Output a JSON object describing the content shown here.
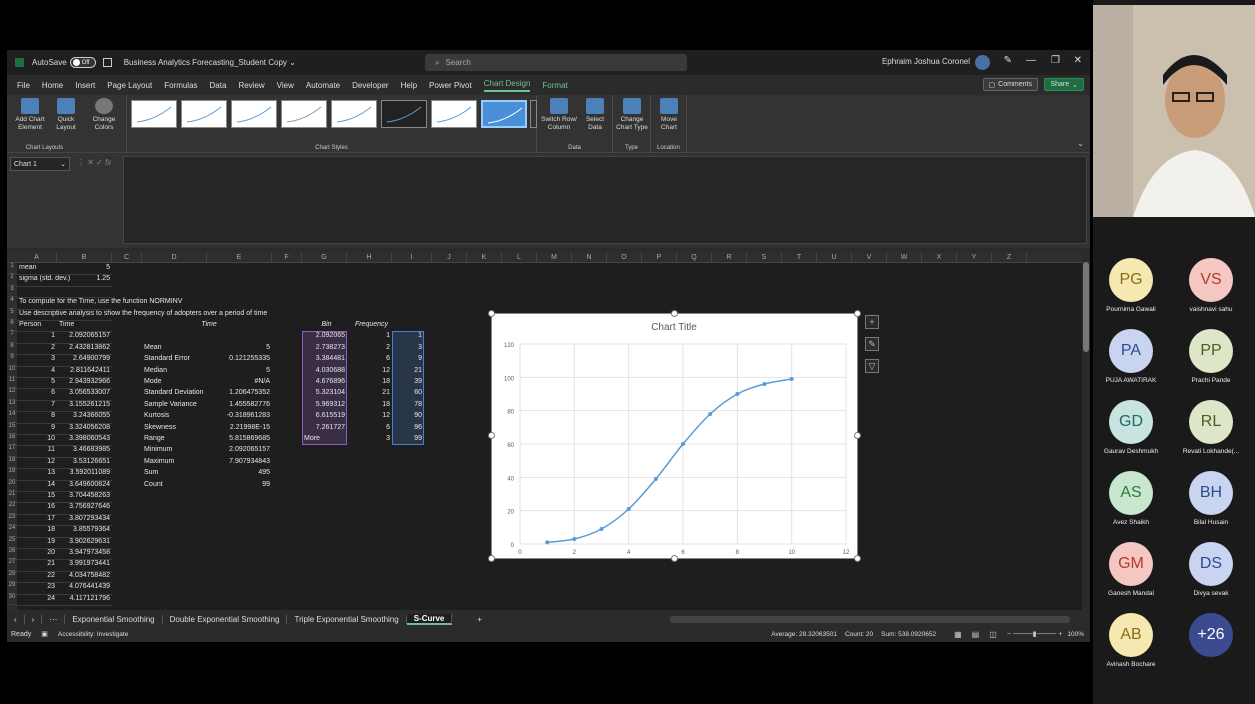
{
  "titlebar": {
    "autosave": "AutoSave",
    "toggle": "Off",
    "filename": "Business Analytics Forecasting_Student Copy ⌄",
    "search": "Search",
    "user": "Ephraim Joshua Coronel"
  },
  "menu": [
    "File",
    "Home",
    "Insert",
    "Page Layout",
    "Formulas",
    "Data",
    "Review",
    "View",
    "Automate",
    "Developer",
    "Help",
    "Power Pivot",
    "Chart Design",
    "Format"
  ],
  "menu_active": "Chart Design",
  "header_buttons": {
    "comments": "Comments",
    "share": "Share"
  },
  "ribbon": {
    "add_chart": "Add Chart Element",
    "quick_layout": "Quick Layout",
    "change_colors": "Change Colors",
    "chart_layouts": "Chart Layouts",
    "chart_styles": "Chart Styles",
    "switch": "Switch Row/ Column",
    "select": "Select Data",
    "data": "Data",
    "change_type": "Change Chart Type",
    "type": "Type",
    "move": "Move Chart",
    "location": "Location"
  },
  "namebox": "Chart 1",
  "columns": [
    "A",
    "B",
    "C",
    "D",
    "E",
    "F",
    "G",
    "H",
    "I",
    "J",
    "K",
    "L",
    "M",
    "N",
    "O",
    "P",
    "Q",
    "R",
    "S",
    "T",
    "U",
    "V",
    "W",
    "X",
    "Y",
    "Z"
  ],
  "a_rows": [
    [
      "mean",
      "5"
    ],
    [
      "sigma (std. dev.)",
      "1.25"
    ],
    [
      "",
      ""
    ],
    [
      "To compute for the Time, use the function NORMINV",
      ""
    ],
    [
      "Use descriptive analysis to show the frequency of adopters over a period of time",
      ""
    ],
    [
      "Person",
      "Time"
    ],
    [
      "1",
      "2.092065157"
    ],
    [
      "2",
      "2.432813862"
    ],
    [
      "3",
      "2.64900799"
    ],
    [
      "4",
      "2.811642411"
    ],
    [
      "5",
      "2.943932966"
    ],
    [
      "6",
      "3.056533007"
    ],
    [
      "7",
      "3.155261215"
    ],
    [
      "8",
      "3.24366055"
    ],
    [
      "9",
      "3.324056208"
    ],
    [
      "10",
      "3.398060543"
    ],
    [
      "11",
      "3.46683985"
    ],
    [
      "12",
      "3.53126651"
    ],
    [
      "13",
      "3.592011089"
    ],
    [
      "14",
      "3.649600824"
    ],
    [
      "15",
      "3.704458263"
    ],
    [
      "16",
      "3.756927646"
    ],
    [
      "17",
      "3.807293434"
    ],
    [
      "18",
      "3.85579364"
    ],
    [
      "19",
      "3.902629631"
    ],
    [
      "20",
      "3.947973458"
    ],
    [
      "21",
      "3.991973441"
    ],
    [
      "22",
      "4.034758482"
    ],
    [
      "23",
      "4.076441439"
    ],
    [
      "24",
      "4.117121796"
    ]
  ],
  "stats_header": "Time",
  "stats": [
    [
      "Mean",
      "5"
    ],
    [
      "Standard Error",
      "0.121255335"
    ],
    [
      "Median",
      "5"
    ],
    [
      "Mode",
      "#N/A"
    ],
    [
      "Standard Deviation",
      "1.206475352"
    ],
    [
      "Sample Variance",
      "1.455582776"
    ],
    [
      "Kurtosis",
      "-0.318961283"
    ],
    [
      "Skewness",
      "2.21998E-15"
    ],
    [
      "Range",
      "5.815869685"
    ],
    [
      "Minimum",
      "2.092065157"
    ],
    [
      "Maximum",
      "7.907934843"
    ],
    [
      "Sum",
      "495"
    ],
    [
      "Count",
      "99"
    ]
  ],
  "bin_headers": [
    "Bin",
    "Frequency"
  ],
  "bins": [
    [
      "2.092065",
      "1",
      "1"
    ],
    [
      "2.738273",
      "2",
      "3"
    ],
    [
      "3.384481",
      "6",
      "9"
    ],
    [
      "4.030688",
      "12",
      "21"
    ],
    [
      "4.676896",
      "18",
      "39"
    ],
    [
      "5.323104",
      "21",
      "60"
    ],
    [
      "5.969312",
      "18",
      "78"
    ],
    [
      "6.615519",
      "12",
      "90"
    ],
    [
      "7.261727",
      "6",
      "96"
    ],
    [
      "More",
      "3",
      "99"
    ]
  ],
  "chart_data": {
    "type": "scatter",
    "title": "Chart Title",
    "xlabel": "",
    "ylabel": "",
    "x": [
      1,
      2,
      3,
      4,
      5,
      6,
      7,
      8,
      9,
      10
    ],
    "y": [
      1,
      3,
      9,
      21,
      39,
      60,
      78,
      90,
      96,
      99
    ],
    "xlim": [
      0,
      12
    ],
    "ylim": [
      0,
      120
    ],
    "xticks": [
      "0",
      "2",
      "4",
      "6",
      "8",
      "10",
      "12"
    ],
    "yticks": [
      "0",
      "20",
      "40",
      "60",
      "80",
      "100",
      "120"
    ],
    "smooth": true,
    "marker": true,
    "color": "#5b9bd5"
  },
  "sheet_tabs": [
    "Exponential Smoothing",
    "Double Exponential Smoothing",
    "Triple Exponential Smoothing",
    "S-Curve"
  ],
  "active_sheet": "S-Curve",
  "status": {
    "ready": "Ready",
    "accessibility": "Accessibility: Investigate",
    "average": "Average: 28.32063501",
    "count": "Count: 20",
    "sum": "Sum: 538.0920652",
    "zoom": "100%"
  },
  "participants": [
    {
      "initials": "PG",
      "name": "Pournima Gawali",
      "bg": "#f5e8b0",
      "fg": "#8a6d1a"
    },
    {
      "initials": "VS",
      "name": "vaishnavi sahu",
      "bg": "#f4c7c3",
      "fg": "#b23a2e"
    },
    {
      "initials": "PA",
      "name": "PUJA AWATIRAK",
      "bg": "#c9d4f0",
      "fg": "#2f4a8f"
    },
    {
      "initials": "PP",
      "name": "Prachi Pande",
      "bg": "#dde6c6",
      "fg": "#4d5b26"
    },
    {
      "initials": "GD",
      "name": "Gaurav Deshmukh",
      "bg": "#c8e4e0",
      "fg": "#1f6b60"
    },
    {
      "initials": "RL",
      "name": "Revati Lokhande(...",
      "bg": "#dde6c6",
      "fg": "#4d5b26"
    },
    {
      "initials": "AS",
      "name": "Avez Shaikh",
      "bg": "#c9e7cf",
      "fg": "#2d7a3e"
    },
    {
      "initials": "BH",
      "name": "Bilal Husain",
      "bg": "#c9d4f0",
      "fg": "#2f4a8f"
    },
    {
      "initials": "GM",
      "name": "Ganesh Mandal",
      "bg": "#f4c7c3",
      "fg": "#b23a2e"
    },
    {
      "initials": "DS",
      "name": "Divya sevak",
      "bg": "#c9d4f0",
      "fg": "#2f4a8f"
    },
    {
      "initials": "AB",
      "name": "Avinash Bochare",
      "bg": "#f5e8b0",
      "fg": "#8a6d1a"
    },
    {
      "initials": "+26",
      "name": "",
      "bg": "#3c4a8f",
      "fg": "#ffffff"
    }
  ]
}
